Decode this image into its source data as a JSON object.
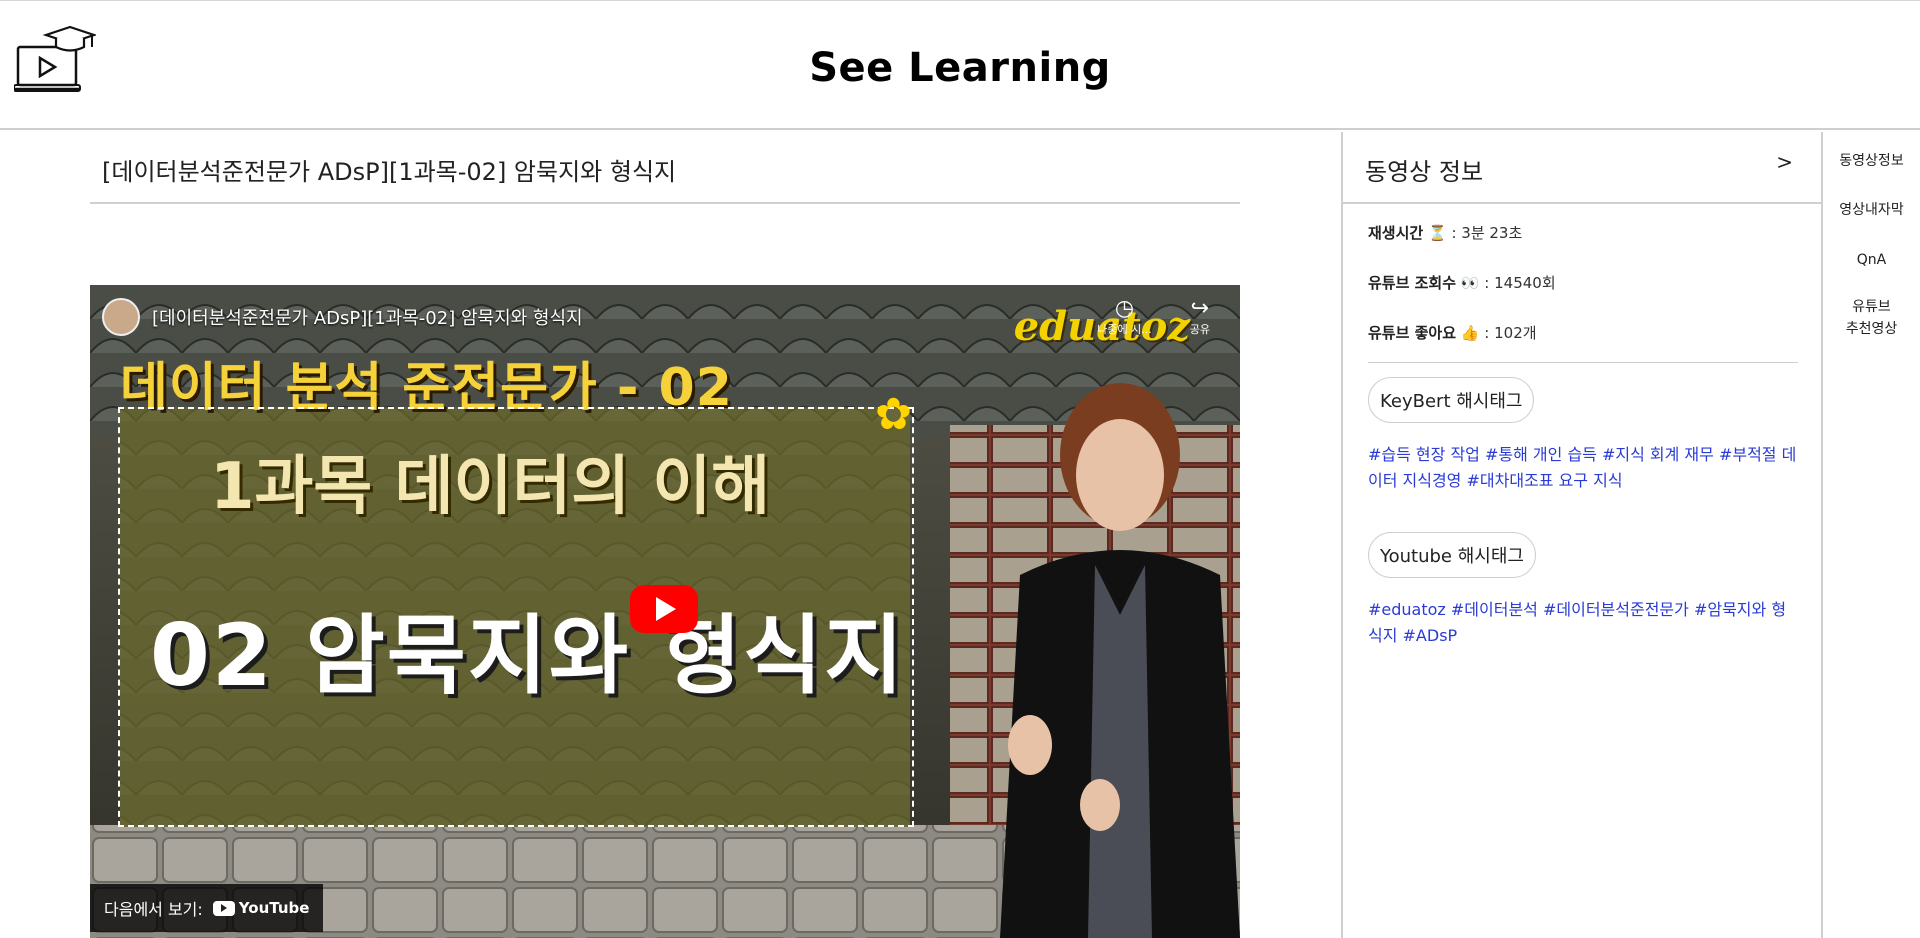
{
  "header": {
    "site_title": "See Learning",
    "logo_icon": "laptop-graduation-cap-icon"
  },
  "main": {
    "video_title": "[데이터분석준전문가 ADsP][1과목-02] 암묵지와 형식지",
    "player": {
      "embed_title": "[데이터분석준전문가 ADsP][1과목-02] 암묵지와 형식지",
      "watch_later_label": "나중에 시...",
      "share_label": "공유",
      "brand": "eduatoz",
      "slide_heading": "데이터 분석 준전문가 - 02",
      "slide_line1": "1과목 데이터의 이해",
      "slide_line2": "02 암묵지와 형식지",
      "watch_on_label": "다음에서 보기:",
      "youtube_label": "YouTube"
    }
  },
  "info_panel": {
    "title": "동영상 정보",
    "arrow": ">",
    "duration_label": "재생시간",
    "duration_icon": "⏳",
    "duration_value": ": 3분 23초",
    "views_label": "유튜브 조회수",
    "views_icon": "👀",
    "views_value": ": 14540회",
    "likes_label": "유튜브 좋아요",
    "likes_icon": "👍",
    "likes_value": ": 102개",
    "keybert_label": "KeyBert 해시태그",
    "keybert_tags": "#습득 현장 작업 #통해 개인 습득 #지식 회계 재무 #부적절 데이터 지식경영 #대차대조표 요구 지식",
    "youtube_tag_label": "Youtube 해시태그",
    "youtube_tags": "#eduatoz #데이터분석 #데이터분석준전문가 #암묵지와 형식지 #ADsP"
  },
  "side_menu": {
    "items": [
      {
        "label": "동영상정보"
      },
      {
        "label": "영상내자막"
      },
      {
        "label": "QnA"
      },
      {
        "label": "유튜브\n추천영상"
      }
    ]
  },
  "colors": {
    "tag_link": "#2a3bd6",
    "youtube_red": "#ff0000",
    "brand_yellow": "#f2d200",
    "divider": "#cfcfcf"
  }
}
